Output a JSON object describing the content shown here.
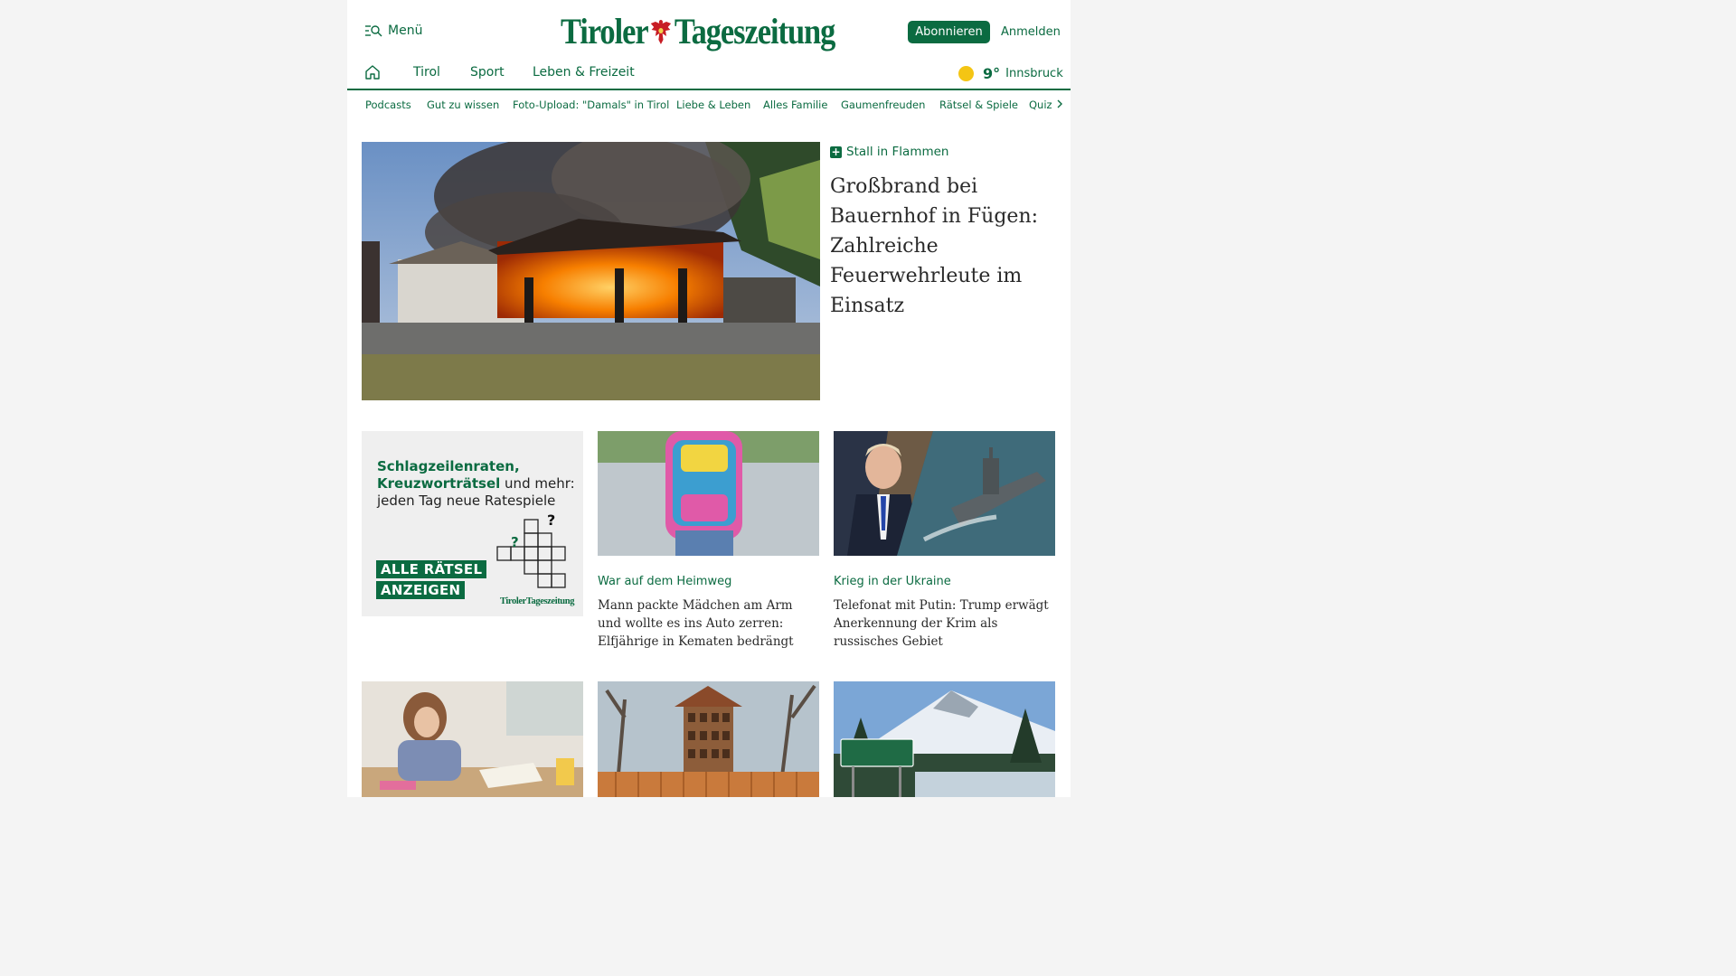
{
  "header": {
    "menu_label": "Menü",
    "logo_left": "Tiroler",
    "logo_right": "Tageszeitung",
    "subscribe_label": "Abonnieren",
    "login_label": "Anmelden"
  },
  "main_nav": {
    "items": [
      {
        "label": "Tirol"
      },
      {
        "label": "Sport"
      },
      {
        "label": "Leben & Freizeit"
      }
    ],
    "weather": {
      "temperature": "9°",
      "city": "Innsbruck",
      "icon": "sun-icon"
    }
  },
  "sub_nav": {
    "items": [
      {
        "label": "Podcasts"
      },
      {
        "label": "Gut zu wissen"
      },
      {
        "label": "Foto-Upload: \"Damals\" in Tirol"
      },
      {
        "label": "Liebe & Leben"
      },
      {
        "label": "Alles Familie"
      },
      {
        "label": "Gaumenfreuden"
      },
      {
        "label": "Rätsel & Spiele"
      },
      {
        "label": "Quiz"
      }
    ]
  },
  "hero": {
    "kicker": "Stall in Flammen",
    "title": "Großbrand bei Bauernhof in Fügen: Zahlreiche Feuerwehrleute im Einsatz"
  },
  "puzzle_promo": {
    "line1": "Schlagzeilenraten,",
    "line2_green": "Kreuzworträtsel",
    "line2_rest": " und mehr:",
    "line3": "jeden Tag neue Ratespiele",
    "button_line1": "ALLE RÄTSEL",
    "button_line2": "ANZEIGEN",
    "logo_text": "TirolerTageszeitung"
  },
  "articles": [
    {
      "kicker": "War auf dem Heimweg",
      "title": "Mann packte Mädchen am Arm und wollte es ins Auto zerren: Elfjährige in Kematen bedrängt"
    },
    {
      "kicker": "Krieg in der Ukraine",
      "title": "Telefonat mit Putin: Trump erwägt Anerkennung der Krim als russisches Gebiet"
    }
  ],
  "colors": {
    "brand_green": "#0b6b41",
    "sun_yellow": "#f4c514"
  }
}
